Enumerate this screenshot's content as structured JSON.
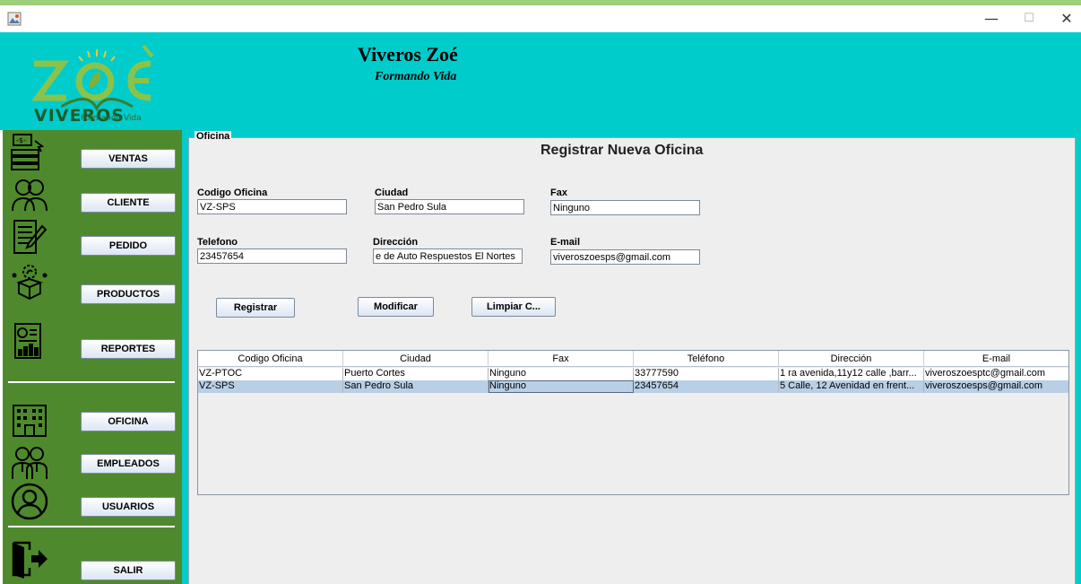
{
  "window": {
    "minimize": "—",
    "maximize": "☐",
    "close": "✕"
  },
  "header": {
    "logo_subtitle": "Formando Vida",
    "title": "Viveros Zoé",
    "tagline": "Formando Vida"
  },
  "sidebar": {
    "items": [
      {
        "label": "VENTAS",
        "icon": "cash-register-icon"
      },
      {
        "label": "CLIENTE",
        "icon": "customers-icon"
      },
      {
        "label": "PEDIDO",
        "icon": "order-form-icon"
      },
      {
        "label": "PRODUCTOS",
        "icon": "plant-box-icon"
      },
      {
        "label": "REPORTES",
        "icon": "report-chart-icon"
      },
      {
        "label": "OFICINA",
        "icon": "office-building-icon"
      },
      {
        "label": "EMPLEADOS",
        "icon": "employees-icon"
      },
      {
        "label": "USUARIOS",
        "icon": "user-circle-icon"
      },
      {
        "label": "SALIR",
        "icon": "exit-door-icon"
      }
    ]
  },
  "form": {
    "group_title": "Oficina",
    "title": "Registrar Nueva Oficina",
    "fields": {
      "codigo": {
        "label": "Codigo Oficina",
        "value": "VZ-SPS"
      },
      "ciudad": {
        "label": "Ciudad",
        "value": "San Pedro Sula"
      },
      "fax": {
        "label": "Fax",
        "value": "Ninguno"
      },
      "telefono": {
        "label": "Telefono",
        "value": "23457654"
      },
      "direccion": {
        "label": "Dirección",
        "value": "e de Auto Respuestos El Nortes"
      },
      "email": {
        "label": "E-mail",
        "value": "viveroszoesps@gmail.com"
      }
    },
    "buttons": {
      "registrar": "Registrar",
      "modificar": "Modificar",
      "limpiar": "Limpiar C..."
    }
  },
  "table": {
    "columns": [
      "Codigo Oficina",
      "Ciudad",
      "Fax",
      "Teléfono",
      "Dirección",
      "E-mail"
    ],
    "rows": [
      [
        "VZ-PTOC",
        "Puerto Cortes",
        "Ninguno",
        "33777590",
        "1 ra avenida,11y12 calle ,barr...",
        "viveroszoesptc@gmail.com"
      ],
      [
        "VZ-SPS",
        "San Pedro Sula",
        "Ninguno",
        "23457654",
        "5 Calle, 12 Avenidad en frent...",
        "viveroszoesps@gmail.com"
      ]
    ],
    "selected_row": 1
  },
  "colors": {
    "header_bg": "#00cccc",
    "sidebar_bg": "#4e8a2d",
    "selected_row": "#b8cfe5"
  }
}
